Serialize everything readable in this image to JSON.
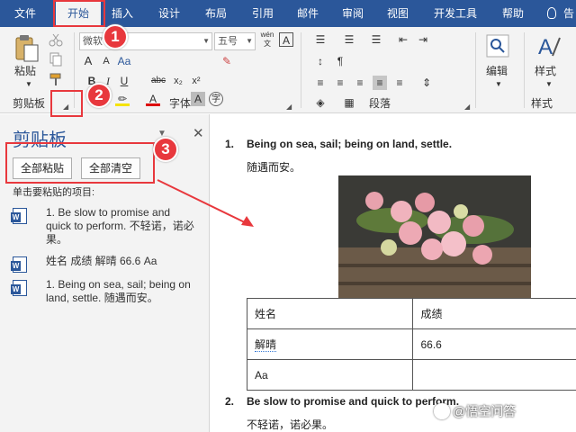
{
  "ribbon_tabs": [
    "文件",
    "开始",
    "插入",
    "设计",
    "布局",
    "引用",
    "邮件",
    "审阅",
    "视图",
    "开发工具",
    "帮助"
  ],
  "tell_me_label": "告",
  "clipboard_group": {
    "paste_label": "粘贴",
    "group_label": "剪贴板"
  },
  "font_group": {
    "font_name": "微软",
    "font_size": "五号",
    "group_label": "字体",
    "wen_label": "wén\n文"
  },
  "paragraph_group": {
    "group_label": "段落"
  },
  "editing_group": {
    "label": "编辑"
  },
  "styles_group": {
    "label": "样式",
    "group_label": "样式"
  },
  "clipboard_pane": {
    "title": "剪贴板",
    "paste_all": "全部粘贴",
    "clear_all": "全部清空",
    "hint": "单击要粘贴的项目:",
    "items": [
      "1. Be slow to promise and quick to perform. 不轻诺，诺必果。",
      "姓名 成绩 解晴 66.6 Aa",
      "1. Being on sea, sail; being on land, settle. 随遇而安。"
    ]
  },
  "document": {
    "item1_num": "1.",
    "item1_title": "Being on sea, sail; being on land, settle.",
    "item1_sub": "随遇而安。",
    "table": [
      [
        "姓名",
        "成绩"
      ],
      [
        "解晴",
        "66.6"
      ],
      [
        "Aa",
        ""
      ]
    ],
    "item2_num": "2.",
    "item2_title": "Be slow to promise and quick to perform.",
    "item2_sub": "不轻诺，诺必果。"
  },
  "annotations": [
    "1",
    "2",
    "3"
  ],
  "watermark": "@悟空问答",
  "colors": {
    "accent": "#2b579a",
    "annotation": "#e8383d"
  }
}
